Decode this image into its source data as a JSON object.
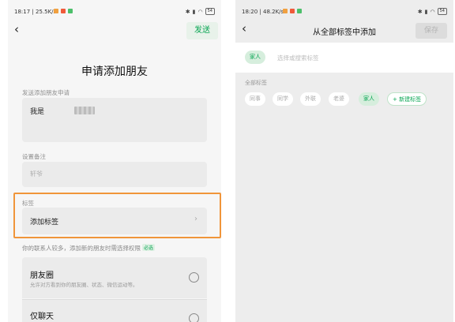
{
  "left_screen": {
    "status": {
      "time": "18:17",
      "speed": "25.5K/s",
      "battery": "54"
    },
    "send_button": "发送",
    "title": "申请添加朋友",
    "request_section": "发送添加朋友申请",
    "request_text": "我是",
    "note_section": "设置备注",
    "note_placeholder": "轩爷",
    "tags_section": "标签",
    "add_tag": "添加标签",
    "permission_notice": "你的联系人较多，添加新的朋友时需选择权限",
    "required_badge": "必选",
    "options": [
      {
        "title": "朋友圈",
        "desc": "允许对方看到你的朋友圈、状态、微信运动等。"
      },
      {
        "title": "仅聊天",
        "desc": ""
      }
    ]
  },
  "right_screen": {
    "status": {
      "time": "18:20",
      "speed": "48.2K/s",
      "battery": "54"
    },
    "title": "从全部标签中添加",
    "save_button": "保存",
    "selected_chip": "家人",
    "search_placeholder": "选择或搜索标签",
    "all_tags_label": "全部标签",
    "tags": [
      "同事",
      "同学",
      "外联",
      "老婆",
      "家人"
    ],
    "new_tag": "新建标签"
  },
  "colors": {
    "accent": "#07a552",
    "highlight": "#f0953a"
  }
}
